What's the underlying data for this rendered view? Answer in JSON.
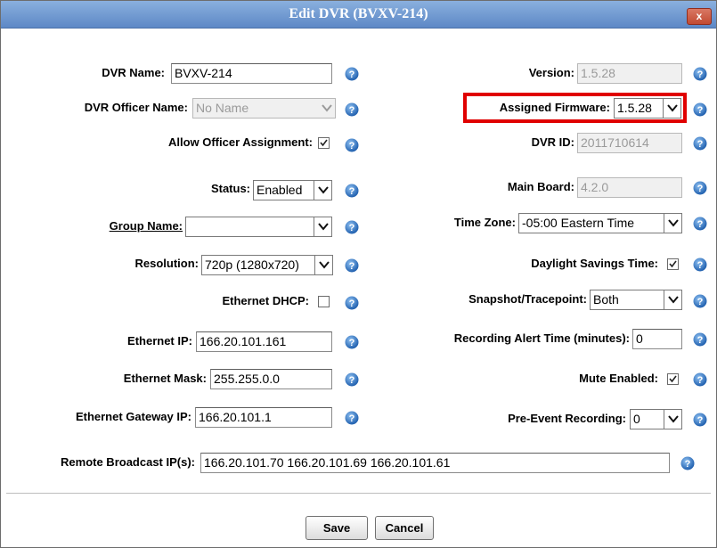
{
  "dialog": {
    "title": "Edit DVR (BVXV-214)",
    "close_label": "x"
  },
  "left": {
    "dvr_name": {
      "label": "DVR Name:",
      "value": "BVXV-214"
    },
    "officer_name": {
      "label": "DVR Officer Name:",
      "value": "No Name"
    },
    "allow_officer": {
      "label": "Allow Officer Assignment:",
      "checked": true
    },
    "status": {
      "label": "Status:",
      "value": "Enabled"
    },
    "group_name": {
      "label": "Group Name:",
      "value": ""
    },
    "resolution": {
      "label": "Resolution:",
      "value": "720p (1280x720)"
    },
    "ethernet_dhcp": {
      "label": "Ethernet DHCP:",
      "checked": false
    },
    "ethernet_ip": {
      "label": "Ethernet IP:",
      "value": "166.20.101.161"
    },
    "ethernet_mask": {
      "label": "Ethernet Mask:",
      "value": "255.255.0.0"
    },
    "ethernet_gateway": {
      "label": "Ethernet Gateway IP:",
      "value": "166.20.101.1"
    }
  },
  "right": {
    "version": {
      "label": "Version:",
      "value": "1.5.28"
    },
    "assigned_firmware": {
      "label": "Assigned Firmware:",
      "value": "1.5.28"
    },
    "dvr_id": {
      "label": "DVR ID:",
      "value": "2011710614"
    },
    "main_board": {
      "label": "Main Board:",
      "value": "4.2.0"
    },
    "time_zone": {
      "label": "Time Zone:",
      "value": "-05:00 Eastern Time"
    },
    "daylight_savings": {
      "label": "Daylight Savings Time:",
      "checked": true
    },
    "snapshot": {
      "label": "Snapshot/Tracepoint:",
      "value": "Both"
    },
    "recording_alert": {
      "label": "Recording Alert Time (minutes):",
      "value": "0"
    },
    "mute_enabled": {
      "label": "Mute Enabled:",
      "checked": true
    },
    "pre_event": {
      "label": "Pre-Event Recording:",
      "value": "0"
    }
  },
  "remote_broadcast": {
    "label": "Remote Broadcast IP(s):",
    "value": "166.20.101.70 166.20.101.69 166.20.101.61"
  },
  "buttons": {
    "save": "Save",
    "cancel": "Cancel"
  },
  "colors": {
    "titlebar": "#6f97d2",
    "highlight": "#e00000",
    "help_icon": "#2f6db8"
  }
}
